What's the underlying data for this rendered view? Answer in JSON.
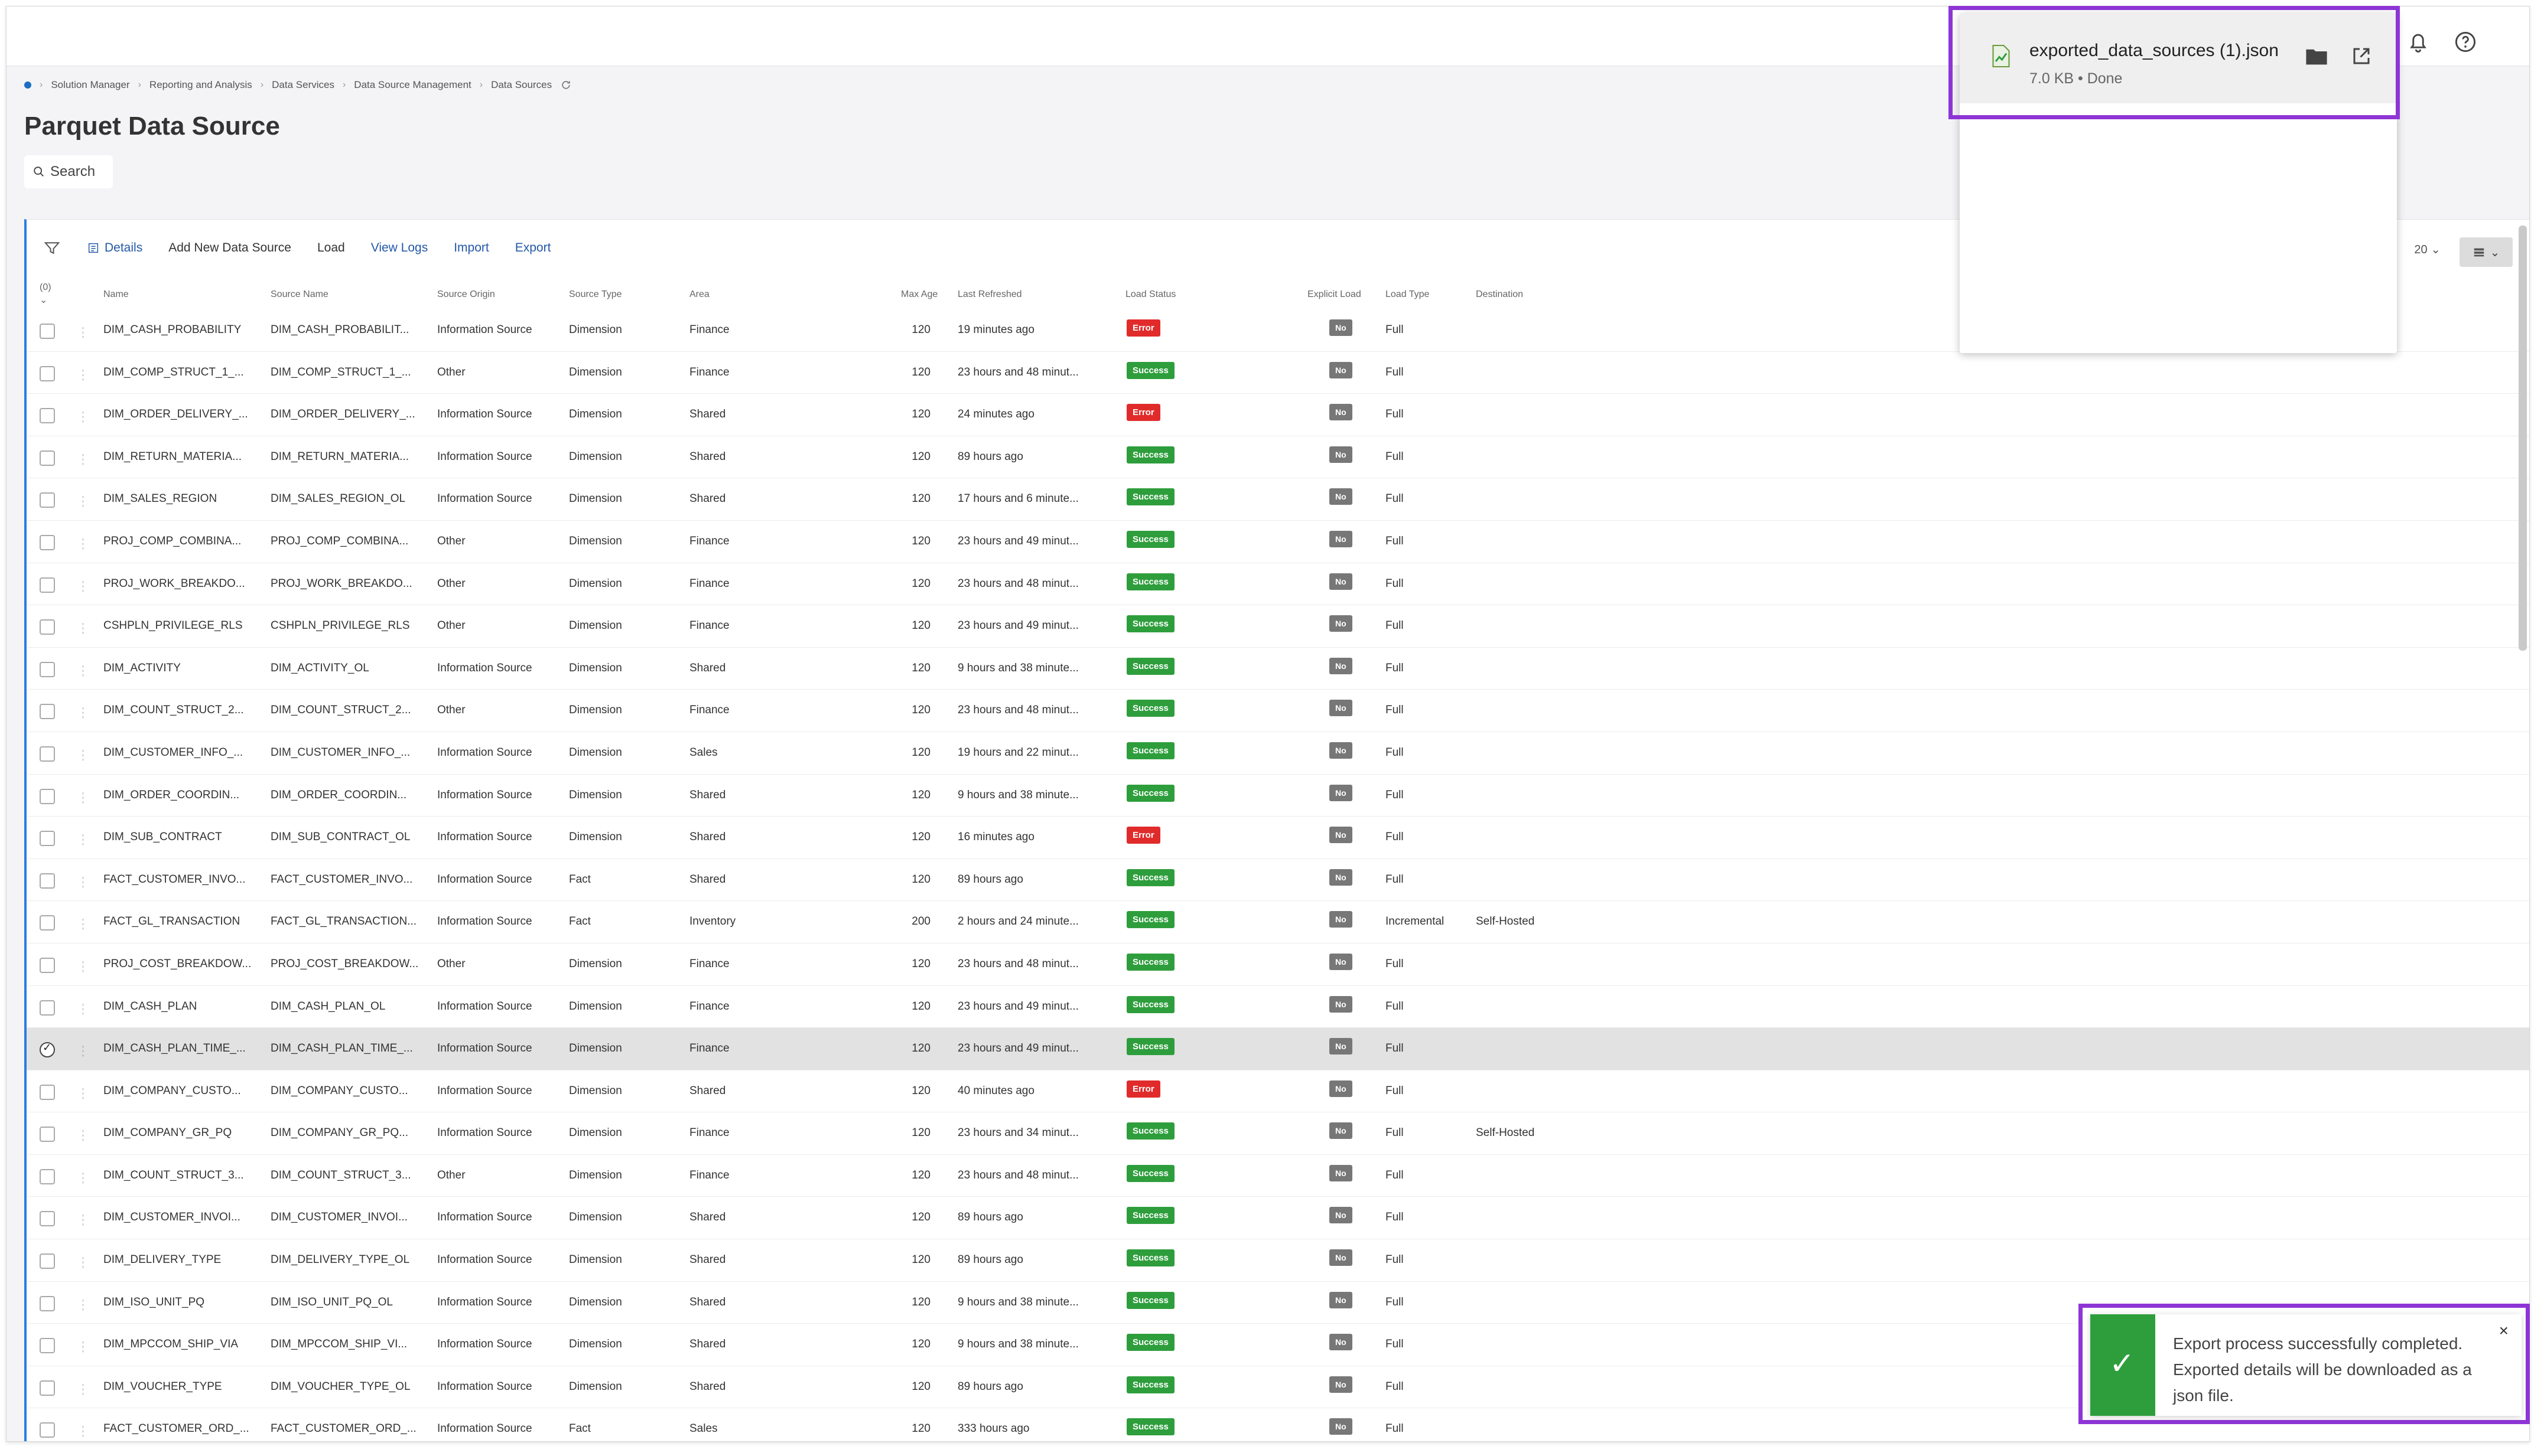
{
  "breadcrumb": [
    "Solution Manager",
    "Reporting and Analysis",
    "Data Services",
    "Data Source Management",
    "Data Sources"
  ],
  "page_title": "Parquet Data Source",
  "search_label": "Search",
  "toolbar": {
    "details": "Details",
    "add": "Add New Data Source",
    "load": "Load",
    "view_logs": "View Logs",
    "import": "Import",
    "export": "Export",
    "page_size": "20"
  },
  "columns": {
    "selected_count": "(0)",
    "name": "Name",
    "source_name": "Source Name",
    "source_origin": "Source Origin",
    "source_type": "Source Type",
    "area": "Area",
    "max_age": "Max Age",
    "last_refreshed": "Last Refreshed",
    "load_status": "Load Status",
    "explicit_load": "Explicit Load",
    "load_type": "Load Type",
    "destination": "Destination"
  },
  "rows": [
    {
      "name": "DIM_CASH_PROBABILITY",
      "source_name": "DIM_CASH_PROBABILIT...",
      "origin": "Information Source",
      "type": "Dimension",
      "area": "Finance",
      "max_age": "120",
      "refreshed": "19 minutes ago",
      "status": "Error",
      "explicit": "No",
      "load_type": "Full",
      "destination": ""
    },
    {
      "name": "DIM_COMP_STRUCT_1_...",
      "source_name": "DIM_COMP_STRUCT_1_...",
      "origin": "Other",
      "type": "Dimension",
      "area": "Finance",
      "max_age": "120",
      "refreshed": "23 hours and 48 minut...",
      "status": "Success",
      "explicit": "No",
      "load_type": "Full",
      "destination": ""
    },
    {
      "name": "DIM_ORDER_DELIVERY_...",
      "source_name": "DIM_ORDER_DELIVERY_...",
      "origin": "Information Source",
      "type": "Dimension",
      "area": "Shared",
      "max_age": "120",
      "refreshed": "24 minutes ago",
      "status": "Error",
      "explicit": "No",
      "load_type": "Full",
      "destination": ""
    },
    {
      "name": "DIM_RETURN_MATERIA...",
      "source_name": "DIM_RETURN_MATERIA...",
      "origin": "Information Source",
      "type": "Dimension",
      "area": "Shared",
      "max_age": "120",
      "refreshed": "89 hours ago",
      "status": "Success",
      "explicit": "No",
      "load_type": "Full",
      "destination": ""
    },
    {
      "name": "DIM_SALES_REGION",
      "source_name": "DIM_SALES_REGION_OL",
      "origin": "Information Source",
      "type": "Dimension",
      "area": "Shared",
      "max_age": "120",
      "refreshed": "17 hours and 6 minute...",
      "status": "Success",
      "explicit": "No",
      "load_type": "Full",
      "destination": ""
    },
    {
      "name": "PROJ_COMP_COMBINA...",
      "source_name": "PROJ_COMP_COMBINA...",
      "origin": "Other",
      "type": "Dimension",
      "area": "Finance",
      "max_age": "120",
      "refreshed": "23 hours and 49 minut...",
      "status": "Success",
      "explicit": "No",
      "load_type": "Full",
      "destination": ""
    },
    {
      "name": "PROJ_WORK_BREAKDO...",
      "source_name": "PROJ_WORK_BREAKDO...",
      "origin": "Other",
      "type": "Dimension",
      "area": "Finance",
      "max_age": "120",
      "refreshed": "23 hours and 48 minut...",
      "status": "Success",
      "explicit": "No",
      "load_type": "Full",
      "destination": ""
    },
    {
      "name": "CSHPLN_PRIVILEGE_RLS",
      "source_name": "CSHPLN_PRIVILEGE_RLS",
      "origin": "Other",
      "type": "Dimension",
      "area": "Finance",
      "max_age": "120",
      "refreshed": "23 hours and 49 minut...",
      "status": "Success",
      "explicit": "No",
      "load_type": "Full",
      "destination": ""
    },
    {
      "name": "DIM_ACTIVITY",
      "source_name": "DIM_ACTIVITY_OL",
      "origin": "Information Source",
      "type": "Dimension",
      "area": "Shared",
      "max_age": "120",
      "refreshed": "9 hours and 38 minute...",
      "status": "Success",
      "explicit": "No",
      "load_type": "Full",
      "destination": ""
    },
    {
      "name": "DIM_COUNT_STRUCT_2...",
      "source_name": "DIM_COUNT_STRUCT_2...",
      "origin": "Other",
      "type": "Dimension",
      "area": "Finance",
      "max_age": "120",
      "refreshed": "23 hours and 48 minut...",
      "status": "Success",
      "explicit": "No",
      "load_type": "Full",
      "destination": ""
    },
    {
      "name": "DIM_CUSTOMER_INFO_...",
      "source_name": "DIM_CUSTOMER_INFO_...",
      "origin": "Information Source",
      "type": "Dimension",
      "area": "Sales",
      "max_age": "120",
      "refreshed": "19 hours and 22 minut...",
      "status": "Success",
      "explicit": "No",
      "load_type": "Full",
      "destination": ""
    },
    {
      "name": "DIM_ORDER_COORDIN...",
      "source_name": "DIM_ORDER_COORDIN...",
      "origin": "Information Source",
      "type": "Dimension",
      "area": "Shared",
      "max_age": "120",
      "refreshed": "9 hours and 38 minute...",
      "status": "Success",
      "explicit": "No",
      "load_type": "Full",
      "destination": ""
    },
    {
      "name": "DIM_SUB_CONTRACT",
      "source_name": "DIM_SUB_CONTRACT_OL",
      "origin": "Information Source",
      "type": "Dimension",
      "area": "Shared",
      "max_age": "120",
      "refreshed": "16 minutes ago",
      "status": "Error",
      "explicit": "No",
      "load_type": "Full",
      "destination": ""
    },
    {
      "name": "FACT_CUSTOMER_INVO...",
      "source_name": "FACT_CUSTOMER_INVO...",
      "origin": "Information Source",
      "type": "Fact",
      "area": "Shared",
      "max_age": "120",
      "refreshed": "89 hours ago",
      "status": "Success",
      "explicit": "No",
      "load_type": "Full",
      "destination": ""
    },
    {
      "name": "FACT_GL_TRANSACTION",
      "source_name": "FACT_GL_TRANSACTION...",
      "origin": "Information Source",
      "type": "Fact",
      "area": "Inventory",
      "max_age": "200",
      "refreshed": "2 hours and 24 minute...",
      "status": "Success",
      "explicit": "No",
      "load_type": "Incremental",
      "destination": "Self-Hosted"
    },
    {
      "name": "PROJ_COST_BREAKDOW...",
      "source_name": "PROJ_COST_BREAKDOW...",
      "origin": "Other",
      "type": "Dimension",
      "area": "Finance",
      "max_age": "120",
      "refreshed": "23 hours and 48 minut...",
      "status": "Success",
      "explicit": "No",
      "load_type": "Full",
      "destination": ""
    },
    {
      "name": "DIM_CASH_PLAN",
      "source_name": "DIM_CASH_PLAN_OL",
      "origin": "Information Source",
      "type": "Dimension",
      "area": "Finance",
      "max_age": "120",
      "refreshed": "23 hours and 49 minut...",
      "status": "Success",
      "explicit": "No",
      "load_type": "Full",
      "destination": ""
    },
    {
      "name": "DIM_CASH_PLAN_TIME_...",
      "source_name": "DIM_CASH_PLAN_TIME_...",
      "origin": "Information Source",
      "type": "Dimension",
      "area": "Finance",
      "max_age": "120",
      "refreshed": "23 hours and 49 minut...",
      "status": "Success",
      "explicit": "No",
      "load_type": "Full",
      "destination": ""
    },
    {
      "name": "DIM_COMPANY_CUSTO...",
      "source_name": "DIM_COMPANY_CUSTO...",
      "origin": "Information Source",
      "type": "Dimension",
      "area": "Shared",
      "max_age": "120",
      "refreshed": "40 minutes ago",
      "status": "Error",
      "explicit": "No",
      "load_type": "Full",
      "destination": ""
    },
    {
      "name": "DIM_COMPANY_GR_PQ",
      "source_name": "DIM_COMPANY_GR_PQ...",
      "origin": "Information Source",
      "type": "Dimension",
      "area": "Finance",
      "max_age": "120",
      "refreshed": "23 hours and 34 minut...",
      "status": "Success",
      "explicit": "No",
      "load_type": "Full",
      "destination": "Self-Hosted"
    },
    {
      "name": "DIM_COUNT_STRUCT_3...",
      "source_name": "DIM_COUNT_STRUCT_3...",
      "origin": "Other",
      "type": "Dimension",
      "area": "Finance",
      "max_age": "120",
      "refreshed": "23 hours and 48 minut...",
      "status": "Success",
      "explicit": "No",
      "load_type": "Full",
      "destination": ""
    },
    {
      "name": "DIM_CUSTOMER_INVOI...",
      "source_name": "DIM_CUSTOMER_INVOI...",
      "origin": "Information Source",
      "type": "Dimension",
      "area": "Shared",
      "max_age": "120",
      "refreshed": "89 hours ago",
      "status": "Success",
      "explicit": "No",
      "load_type": "Full",
      "destination": ""
    },
    {
      "name": "DIM_DELIVERY_TYPE",
      "source_name": "DIM_DELIVERY_TYPE_OL",
      "origin": "Information Source",
      "type": "Dimension",
      "area": "Shared",
      "max_age": "120",
      "refreshed": "89 hours ago",
      "status": "Success",
      "explicit": "No",
      "load_type": "Full",
      "destination": ""
    },
    {
      "name": "DIM_ISO_UNIT_PQ",
      "source_name": "DIM_ISO_UNIT_PQ_OL",
      "origin": "Information Source",
      "type": "Dimension",
      "area": "Shared",
      "max_age": "120",
      "refreshed": "9 hours and 38 minute...",
      "status": "Success",
      "explicit": "No",
      "load_type": "Full",
      "destination": ""
    },
    {
      "name": "DIM_MPCCOM_SHIP_VIA",
      "source_name": "DIM_MPCCOM_SHIP_VI...",
      "origin": "Information Source",
      "type": "Dimension",
      "area": "Shared",
      "max_age": "120",
      "refreshed": "9 hours and 38 minute...",
      "status": "Success",
      "explicit": "No",
      "load_type": "Full",
      "destination": ""
    },
    {
      "name": "DIM_VOUCHER_TYPE",
      "source_name": "DIM_VOUCHER_TYPE_OL",
      "origin": "Information Source",
      "type": "Dimension",
      "area": "Shared",
      "max_age": "120",
      "refreshed": "89 hours ago",
      "status": "Success",
      "explicit": "No",
      "load_type": "Full",
      "destination": ""
    },
    {
      "name": "FACT_CUSTOMER_ORD_...",
      "source_name": "FACT_CUSTOMER_ORD_...",
      "origin": "Information Source",
      "type": "Fact",
      "area": "Sales",
      "max_age": "120",
      "refreshed": "333 hours ago",
      "status": "Success",
      "explicit": "No",
      "load_type": "Full",
      "destination": ""
    }
  ],
  "selected_row_index": 17,
  "download": {
    "file_name": "exported_data_sources (1).json",
    "meta": "7.0 KB • Done"
  },
  "toast": {
    "message": "Export process successfully completed. Exported details will be downloaded as a json file."
  },
  "colors": {
    "success": "#2e9e3c",
    "error": "#e12b2b",
    "highlight": "#8d35d5",
    "link": "#2458a8"
  }
}
